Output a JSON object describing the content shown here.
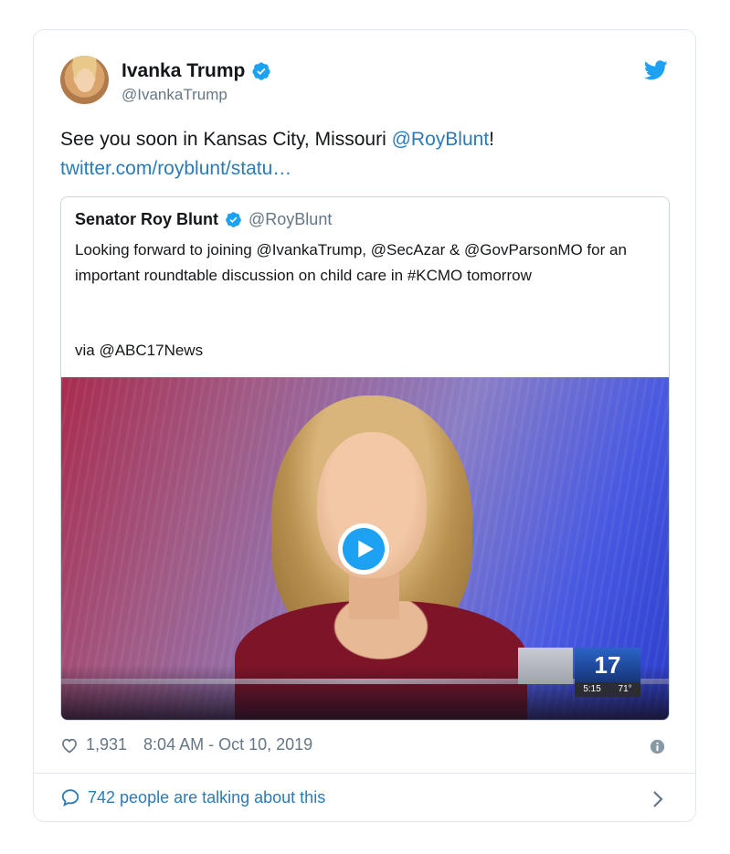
{
  "tweet": {
    "author_name": "Ivanka Trump",
    "author_handle": "@IvankaTrump",
    "text_before": "See you soon in Kansas City, Missouri ",
    "mention": "@RoyBlunt",
    "text_after": "!",
    "link": "twitter.com/royblunt/statu…",
    "likes": "1,931",
    "timestamp": "8:04 AM - Oct 10, 2019",
    "talking": "742 people are talking about this"
  },
  "quoted": {
    "author_name": "Senator Roy Blunt",
    "author_handle": "@RoyBlunt",
    "text": "Looking forward to joining @IvankaTrump, @SecAzar & @GovParsonMO for an important roundtable discussion on child care in #KCMO tomorrow",
    "via": "via @ABC17News"
  },
  "video": {
    "bug_number": "17",
    "bug_time": "5:15",
    "bug_temp": "71°"
  },
  "colors": {
    "verified": "#1da1f2",
    "link": "#2b7bb9",
    "muted": "#657786",
    "border": "#e1e8ed"
  },
  "icons": [
    "verified-badge-icon",
    "twitter-bird-icon",
    "play-icon",
    "heart-icon",
    "info-icon",
    "chat-bubble-icon",
    "chevron-right-icon"
  ]
}
